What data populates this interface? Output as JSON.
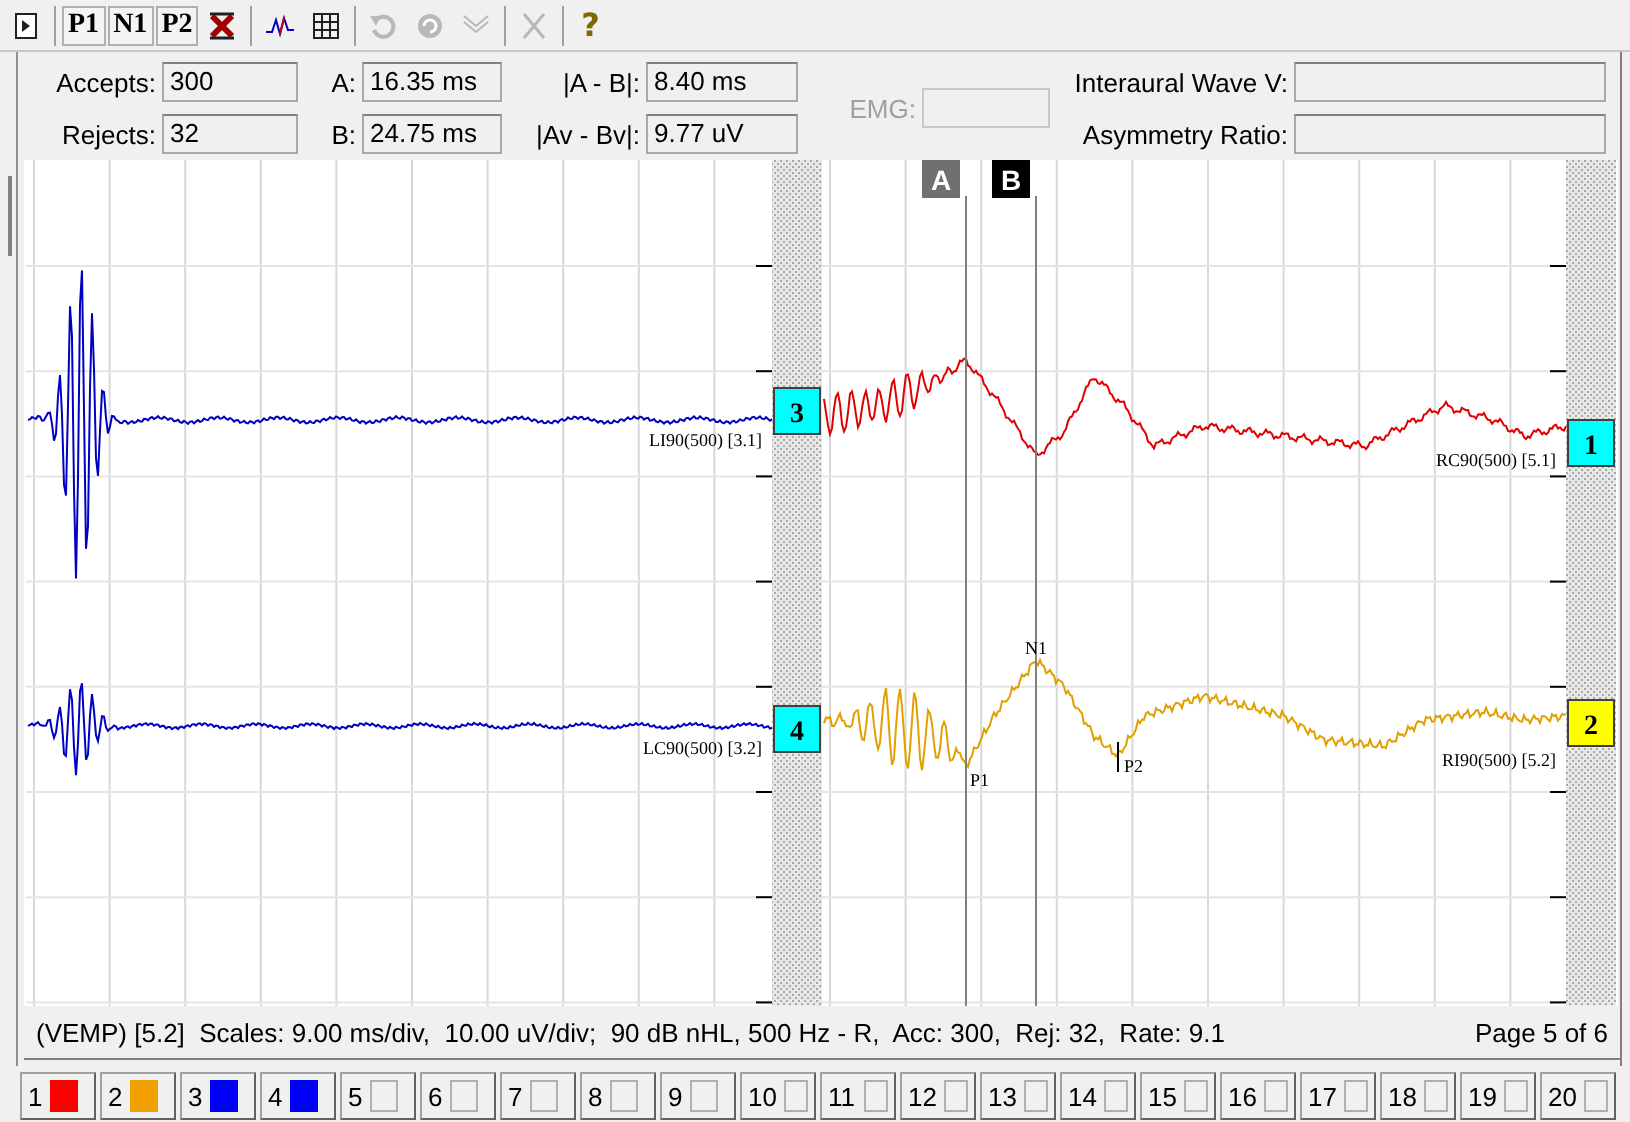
{
  "toolbar": {
    "groups": [
      [
        {
          "kind": "page",
          "disabled": false
        }
      ],
      [
        {
          "kind": "label",
          "label": "P1",
          "disabled": false
        },
        {
          "kind": "label",
          "label": "N1",
          "disabled": false
        },
        {
          "kind": "label",
          "label": "P2",
          "disabled": false
        },
        {
          "kind": "clear",
          "disabled": false
        }
      ],
      [
        {
          "kind": "trace",
          "disabled": false
        },
        {
          "kind": "grid",
          "disabled": false
        }
      ],
      [
        {
          "kind": "undo",
          "disabled": true
        },
        {
          "kind": "reload",
          "disabled": true
        },
        {
          "kind": "wave",
          "disabled": true
        }
      ],
      [
        {
          "kind": "cut",
          "disabled": true
        }
      ],
      [
        {
          "kind": "help",
          "label": "?",
          "disabled": false
        }
      ]
    ]
  },
  "info": {
    "accepts": {
      "label": "Accepts:",
      "value": "300"
    },
    "rejects": {
      "label": "Rejects:",
      "value": "32"
    },
    "a": {
      "label": "A:",
      "value": "16.35 ms"
    },
    "b": {
      "label": "B:",
      "value": "24.75 ms"
    },
    "a_minus_b": {
      "label": "|A - B|:",
      "value": "8.40 ms"
    },
    "av_minus_bv": {
      "label": "|Av - Bv|:",
      "value": "9.77 uV"
    },
    "emg": {
      "label": "EMG:",
      "disabled": true
    },
    "interaural": {
      "label": "Interaural Wave V:"
    },
    "asymmetry": {
      "label": "Asymmetry Ratio:"
    }
  },
  "plot": {
    "cursors": [
      {
        "label": "A",
        "selected": false
      },
      {
        "label": "B",
        "selected": true
      }
    ],
    "panes": [
      {
        "traces": [
          {
            "label": "LI90(500) [3.1]",
            "badge": "3",
            "color": "#0000c0",
            "selected": false
          },
          {
            "label": "LC90(500) [3.2]",
            "badge": "4",
            "color": "#0000c0",
            "selected": false
          }
        ]
      },
      {
        "traces": [
          {
            "label": "RC90(500) [5.1]",
            "badge": "1",
            "color": "#e00000",
            "selected": false
          },
          {
            "label": "RI90(500) [5.2]",
            "badge": "2",
            "color": "#e0a000",
            "selected": true
          }
        ]
      }
    ],
    "peaks": [
      {
        "label": "P1"
      },
      {
        "label": "N1"
      },
      {
        "label": "P2"
      }
    ]
  },
  "status": {
    "text": "(VEMP) [5.2]  Scales: 9.00 ms/div,  10.00 uV/div;  90 dB nHL, 500 Hz - R,  Acc: 300,  Rej: 32,  Rate: 9.1",
    "page": "Page 5 of 6"
  },
  "channels": [
    {
      "label": "1",
      "color": "#ff0000"
    },
    {
      "label": "2",
      "color": "#f0a000"
    },
    {
      "label": "3",
      "color": "#0000ff"
    },
    {
      "label": "4",
      "color": "#0000ff"
    },
    {
      "label": "5"
    },
    {
      "label": "6"
    },
    {
      "label": "7"
    },
    {
      "label": "8"
    },
    {
      "label": "9"
    },
    {
      "label": "10"
    },
    {
      "label": "11"
    },
    {
      "label": "12"
    },
    {
      "label": "13"
    },
    {
      "label": "14"
    },
    {
      "label": "15"
    },
    {
      "label": "16"
    },
    {
      "label": "17"
    },
    {
      "label": "18"
    },
    {
      "label": "19"
    },
    {
      "label": "20"
    }
  ]
}
